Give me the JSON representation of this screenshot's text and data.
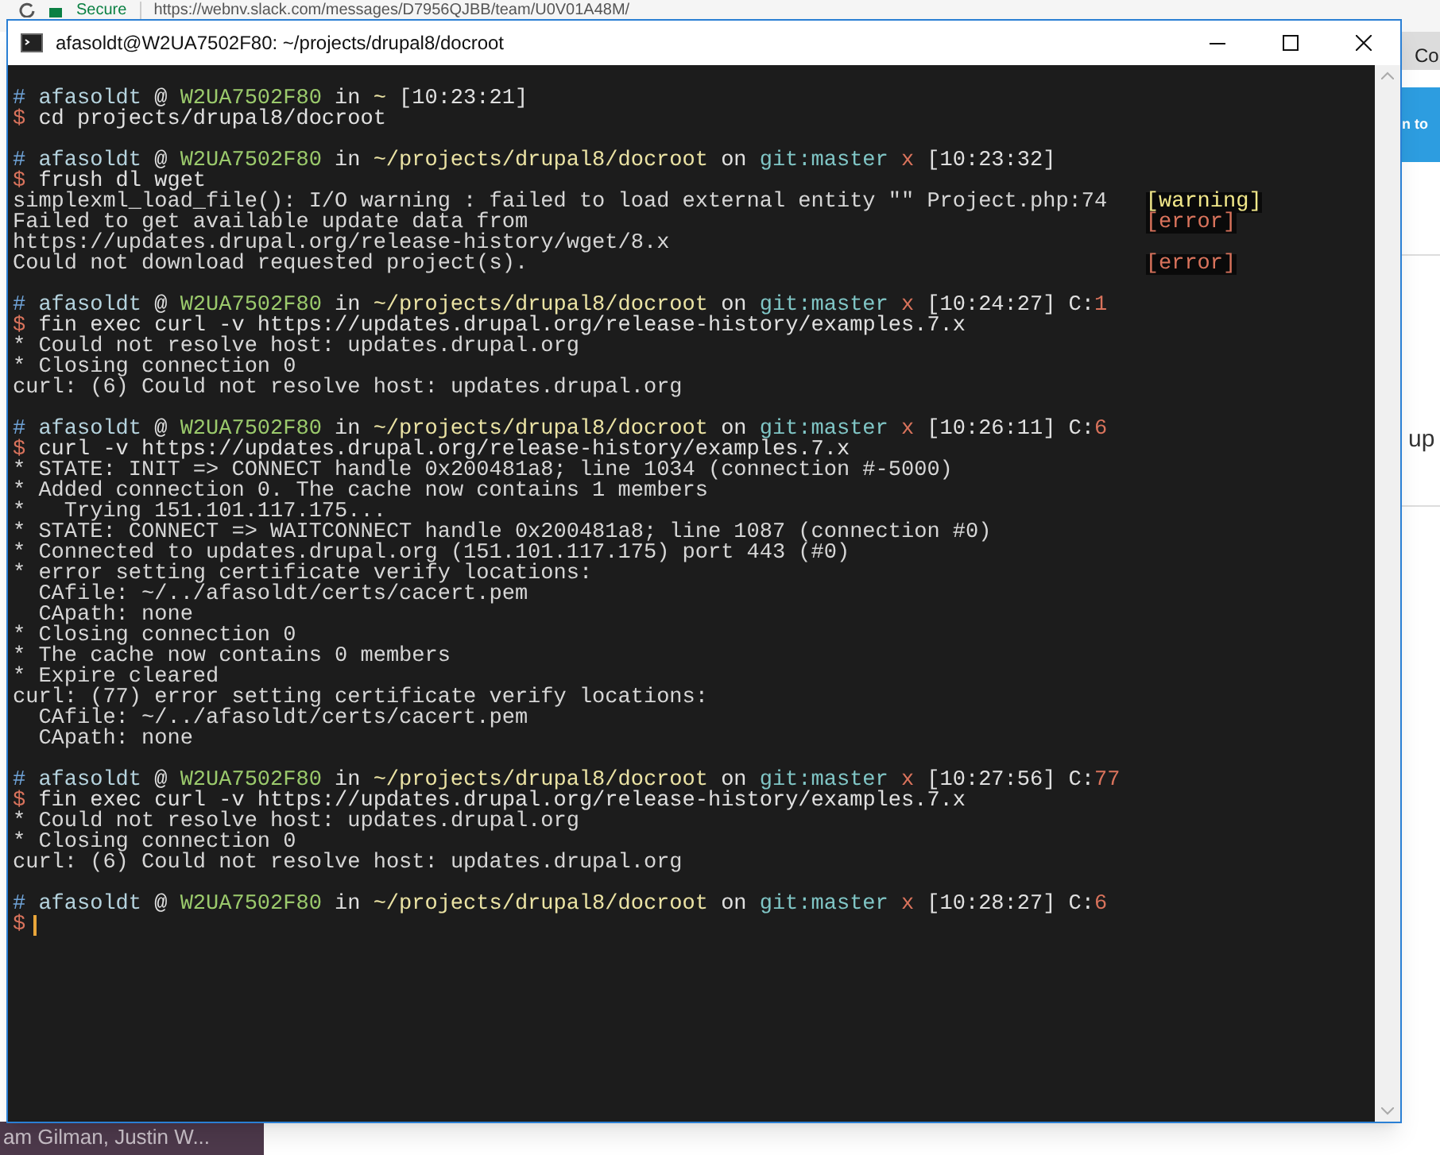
{
  "browser": {
    "security": "Secure",
    "url": "https://webnv.slack.com/messages/D7956QJBB/team/U0V01A48M/",
    "tab_fragment": "Co",
    "banner_fragment": "n to",
    "text_fragment": "up",
    "sidebar_fragment": "am Gilman, Justin W..."
  },
  "window": {
    "title": "afasoldt@W2UA7502F80: ~/projects/drupal8/docroot"
  },
  "terminal": {
    "sessions": [
      {
        "prompt": {
          "symbol": "#",
          "user": "afasoldt",
          "at": "@",
          "host": "W2UA7502F80",
          "in": "in",
          "path": "~",
          "time": "[10:23:21]"
        },
        "command_symbol": "$",
        "command": "cd projects/drupal8/docroot"
      },
      {
        "prompt": {
          "symbol": "#",
          "user": "afasoldt",
          "at": "@",
          "host": "W2UA7502F80",
          "in": "in",
          "path": "~/projects/drupal8/docroot",
          "git": {
            "on": "on",
            "branch": "git:master",
            "dirty": "x"
          },
          "time": "[10:23:32]"
        },
        "command_symbol": "$",
        "command": "frush dl wget",
        "output": [
          {
            "text": "simplexml_load_file(): I/O warning : failed to load external entity \"\" Project.php:74",
            "tag": {
              "text": "[warning]",
              "kind": "warning"
            }
          },
          {
            "text": "Failed to get available update data from",
            "tag": {
              "text": "[error]",
              "kind": "error"
            }
          },
          {
            "text": "https://updates.drupal.org/release-history/wget/8.x"
          },
          {
            "text": "Could not download requested project(s).",
            "tag": {
              "text": "[error]",
              "kind": "error"
            }
          }
        ]
      },
      {
        "prompt": {
          "symbol": "#",
          "user": "afasoldt",
          "at": "@",
          "host": "W2UA7502F80",
          "in": "in",
          "path": "~/projects/drupal8/docroot",
          "git": {
            "on": "on",
            "branch": "git:master",
            "dirty": "x"
          },
          "time": "[10:24:27]",
          "exit": {
            "label": "C:",
            "code": "1"
          }
        },
        "command_symbol": "$",
        "command": "fin exec curl -v https://updates.drupal.org/release-history/examples.7.x",
        "output": [
          {
            "text": "* Could not resolve host: updates.drupal.org"
          },
          {
            "text": "* Closing connection 0"
          },
          {
            "text": "curl: (6) Could not resolve host: updates.drupal.org"
          }
        ]
      },
      {
        "prompt": {
          "symbol": "#",
          "user": "afasoldt",
          "at": "@",
          "host": "W2UA7502F80",
          "in": "in",
          "path": "~/projects/drupal8/docroot",
          "git": {
            "on": "on",
            "branch": "git:master",
            "dirty": "x"
          },
          "time": "[10:26:11]",
          "exit": {
            "label": "C:",
            "code": "6"
          }
        },
        "command_symbol": "$",
        "command": "curl -v https://updates.drupal.org/release-history/examples.7.x",
        "output": [
          {
            "text": "* STATE: INIT => CONNECT handle 0x200481a8; line 1034 (connection #-5000)"
          },
          {
            "text": "* Added connection 0. The cache now contains 1 members"
          },
          {
            "text": "*   Trying 151.101.117.175..."
          },
          {
            "text": "* STATE: CONNECT => WAITCONNECT handle 0x200481a8; line 1087 (connection #0)"
          },
          {
            "text": "* Connected to updates.drupal.org (151.101.117.175) port 443 (#0)"
          },
          {
            "text": "* error setting certificate verify locations:"
          },
          {
            "text": "  CAfile: ~/../afasoldt/certs/cacert.pem"
          },
          {
            "text": "  CApath: none"
          },
          {
            "text": "* Closing connection 0"
          },
          {
            "text": "* The cache now contains 0 members"
          },
          {
            "text": "* Expire cleared"
          },
          {
            "text": "curl: (77) error setting certificate verify locations:"
          },
          {
            "text": "  CAfile: ~/../afasoldt/certs/cacert.pem"
          },
          {
            "text": "  CApath: none"
          }
        ]
      },
      {
        "prompt": {
          "symbol": "#",
          "user": "afasoldt",
          "at": "@",
          "host": "W2UA7502F80",
          "in": "in",
          "path": "~/projects/drupal8/docroot",
          "git": {
            "on": "on",
            "branch": "git:master",
            "dirty": "x"
          },
          "time": "[10:27:56]",
          "exit": {
            "label": "C:",
            "code": "77"
          }
        },
        "command_symbol": "$",
        "command": "fin exec curl -v https://updates.drupal.org/release-history/examples.7.x",
        "output": [
          {
            "text": "* Could not resolve host: updates.drupal.org"
          },
          {
            "text": "* Closing connection 0"
          },
          {
            "text": "curl: (6) Could not resolve host: updates.drupal.org"
          }
        ]
      },
      {
        "prompt": {
          "symbol": "#",
          "user": "afasoldt",
          "at": "@",
          "host": "W2UA7502F80",
          "in": "in",
          "path": "~/projects/drupal8/docroot",
          "git": {
            "on": "on",
            "branch": "git:master",
            "dirty": "x"
          },
          "time": "[10:28:27]",
          "exit": {
            "label": "C:",
            "code": "6"
          }
        },
        "command_symbol": "$",
        "cursor": true
      }
    ]
  }
}
